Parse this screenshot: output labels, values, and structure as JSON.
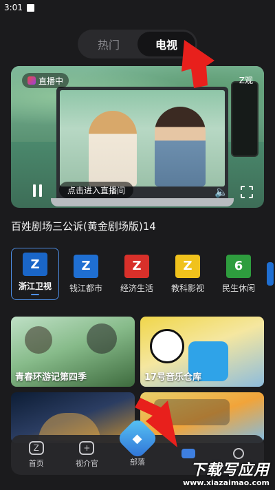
{
  "status_bar": {
    "time": "3:01"
  },
  "segment": {
    "tabs": [
      {
        "label": "热门"
      },
      {
        "label": "电视"
      }
    ],
    "active": "电视"
  },
  "player": {
    "live_badge": "直播中",
    "brand": "Z观",
    "enter_live": "点击进入直播间"
  },
  "program_title": "百姓剧场三公诉(黄金剧场版)14",
  "channels": [
    {
      "label": "浙江卫视",
      "color": "#1a66c8",
      "active": true
    },
    {
      "label": "钱江都市",
      "color": "#1f6fd2"
    },
    {
      "label": "经济生活",
      "color": "#d8302a"
    },
    {
      "label": "教科影视",
      "color": "#f0c21c"
    },
    {
      "label": "民生休闲",
      "color": "#2e9d3e"
    },
    {
      "label": "",
      "color": "#1f6fd2"
    }
  ],
  "cards": [
    {
      "title": "青春环游记第四季"
    },
    {
      "title": "17号音乐仓库"
    },
    {
      "title": ""
    },
    {
      "title": ""
    }
  ],
  "tabbar": {
    "items": [
      {
        "label": "首页"
      },
      {
        "label": "视介官"
      },
      {
        "label": "部落"
      },
      {
        "label": ""
      },
      {
        "label": ""
      }
    ]
  },
  "watermark": {
    "text": "下载写应用",
    "sub": "www.xiazaimao.com"
  },
  "colors": {
    "background": "#1b1b1d",
    "accent": "#4e8fe6",
    "arrow": "#e8201c"
  }
}
